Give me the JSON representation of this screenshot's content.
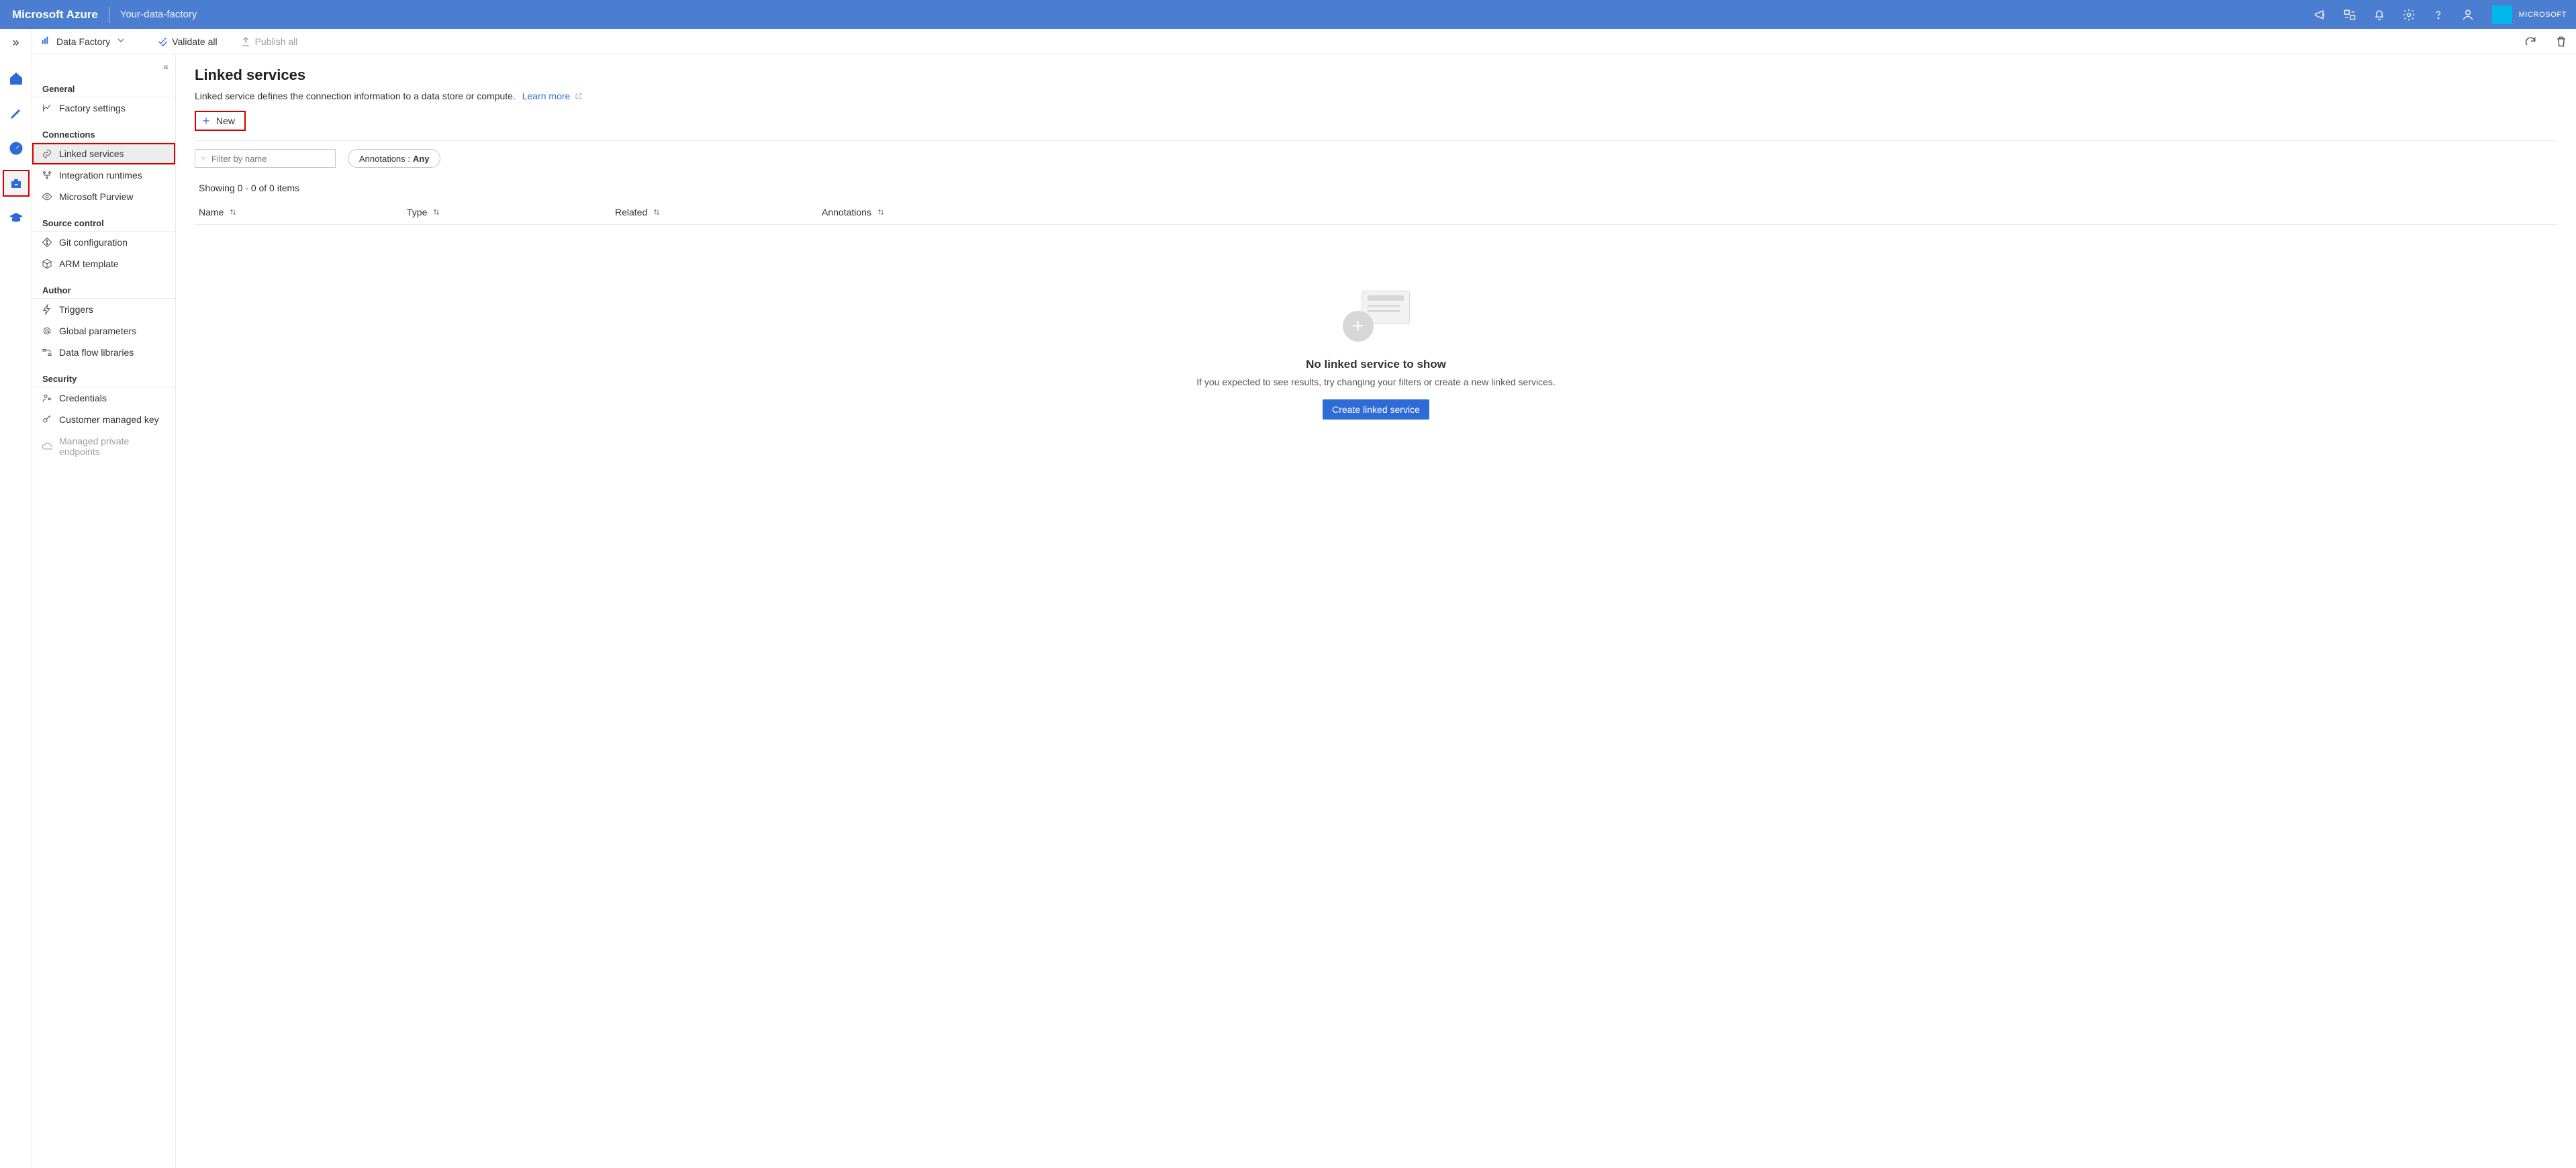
{
  "header": {
    "brand": "Microsoft Azure",
    "factory_name": "Your-data-factory",
    "account_org": "MICROSOFT"
  },
  "rail": {
    "expand_glyph": "»"
  },
  "commandbar": {
    "data_factory_label": "Data Factory",
    "validate_label": "Validate all",
    "publish_label": "Publish all"
  },
  "nav": {
    "collapse_glyph": "«",
    "sections": {
      "general": "General",
      "connections": "Connections",
      "source_control": "Source control",
      "author": "Author",
      "security": "Security"
    },
    "items": {
      "factory_settings": "Factory settings",
      "linked_services": "Linked services",
      "integration_runtimes": "Integration runtimes",
      "microsoft_purview": "Microsoft Purview",
      "git_config": "Git configuration",
      "arm_template": "ARM template",
      "triggers": "Triggers",
      "global_params": "Global parameters",
      "dataflow_libs": "Data flow libraries",
      "credentials": "Credentials",
      "cmk": "Customer managed key",
      "mpe": "Managed private endpoints"
    }
  },
  "page": {
    "title": "Linked services",
    "description": "Linked service defines the connection information to a data store or compute.",
    "learn_more": "Learn more",
    "new_button": "New",
    "filter_placeholder": "Filter by name",
    "annotations_label": "Annotations :",
    "annotations_value": "Any",
    "result_count": "Showing 0 - 0 of 0 items",
    "columns": {
      "name": "Name",
      "type": "Type",
      "related": "Related",
      "annotations": "Annotations"
    },
    "empty": {
      "heading": "No linked service to show",
      "sub": "If you expected to see results, try changing your filters or create a new linked services.",
      "cta": "Create linked service"
    }
  }
}
